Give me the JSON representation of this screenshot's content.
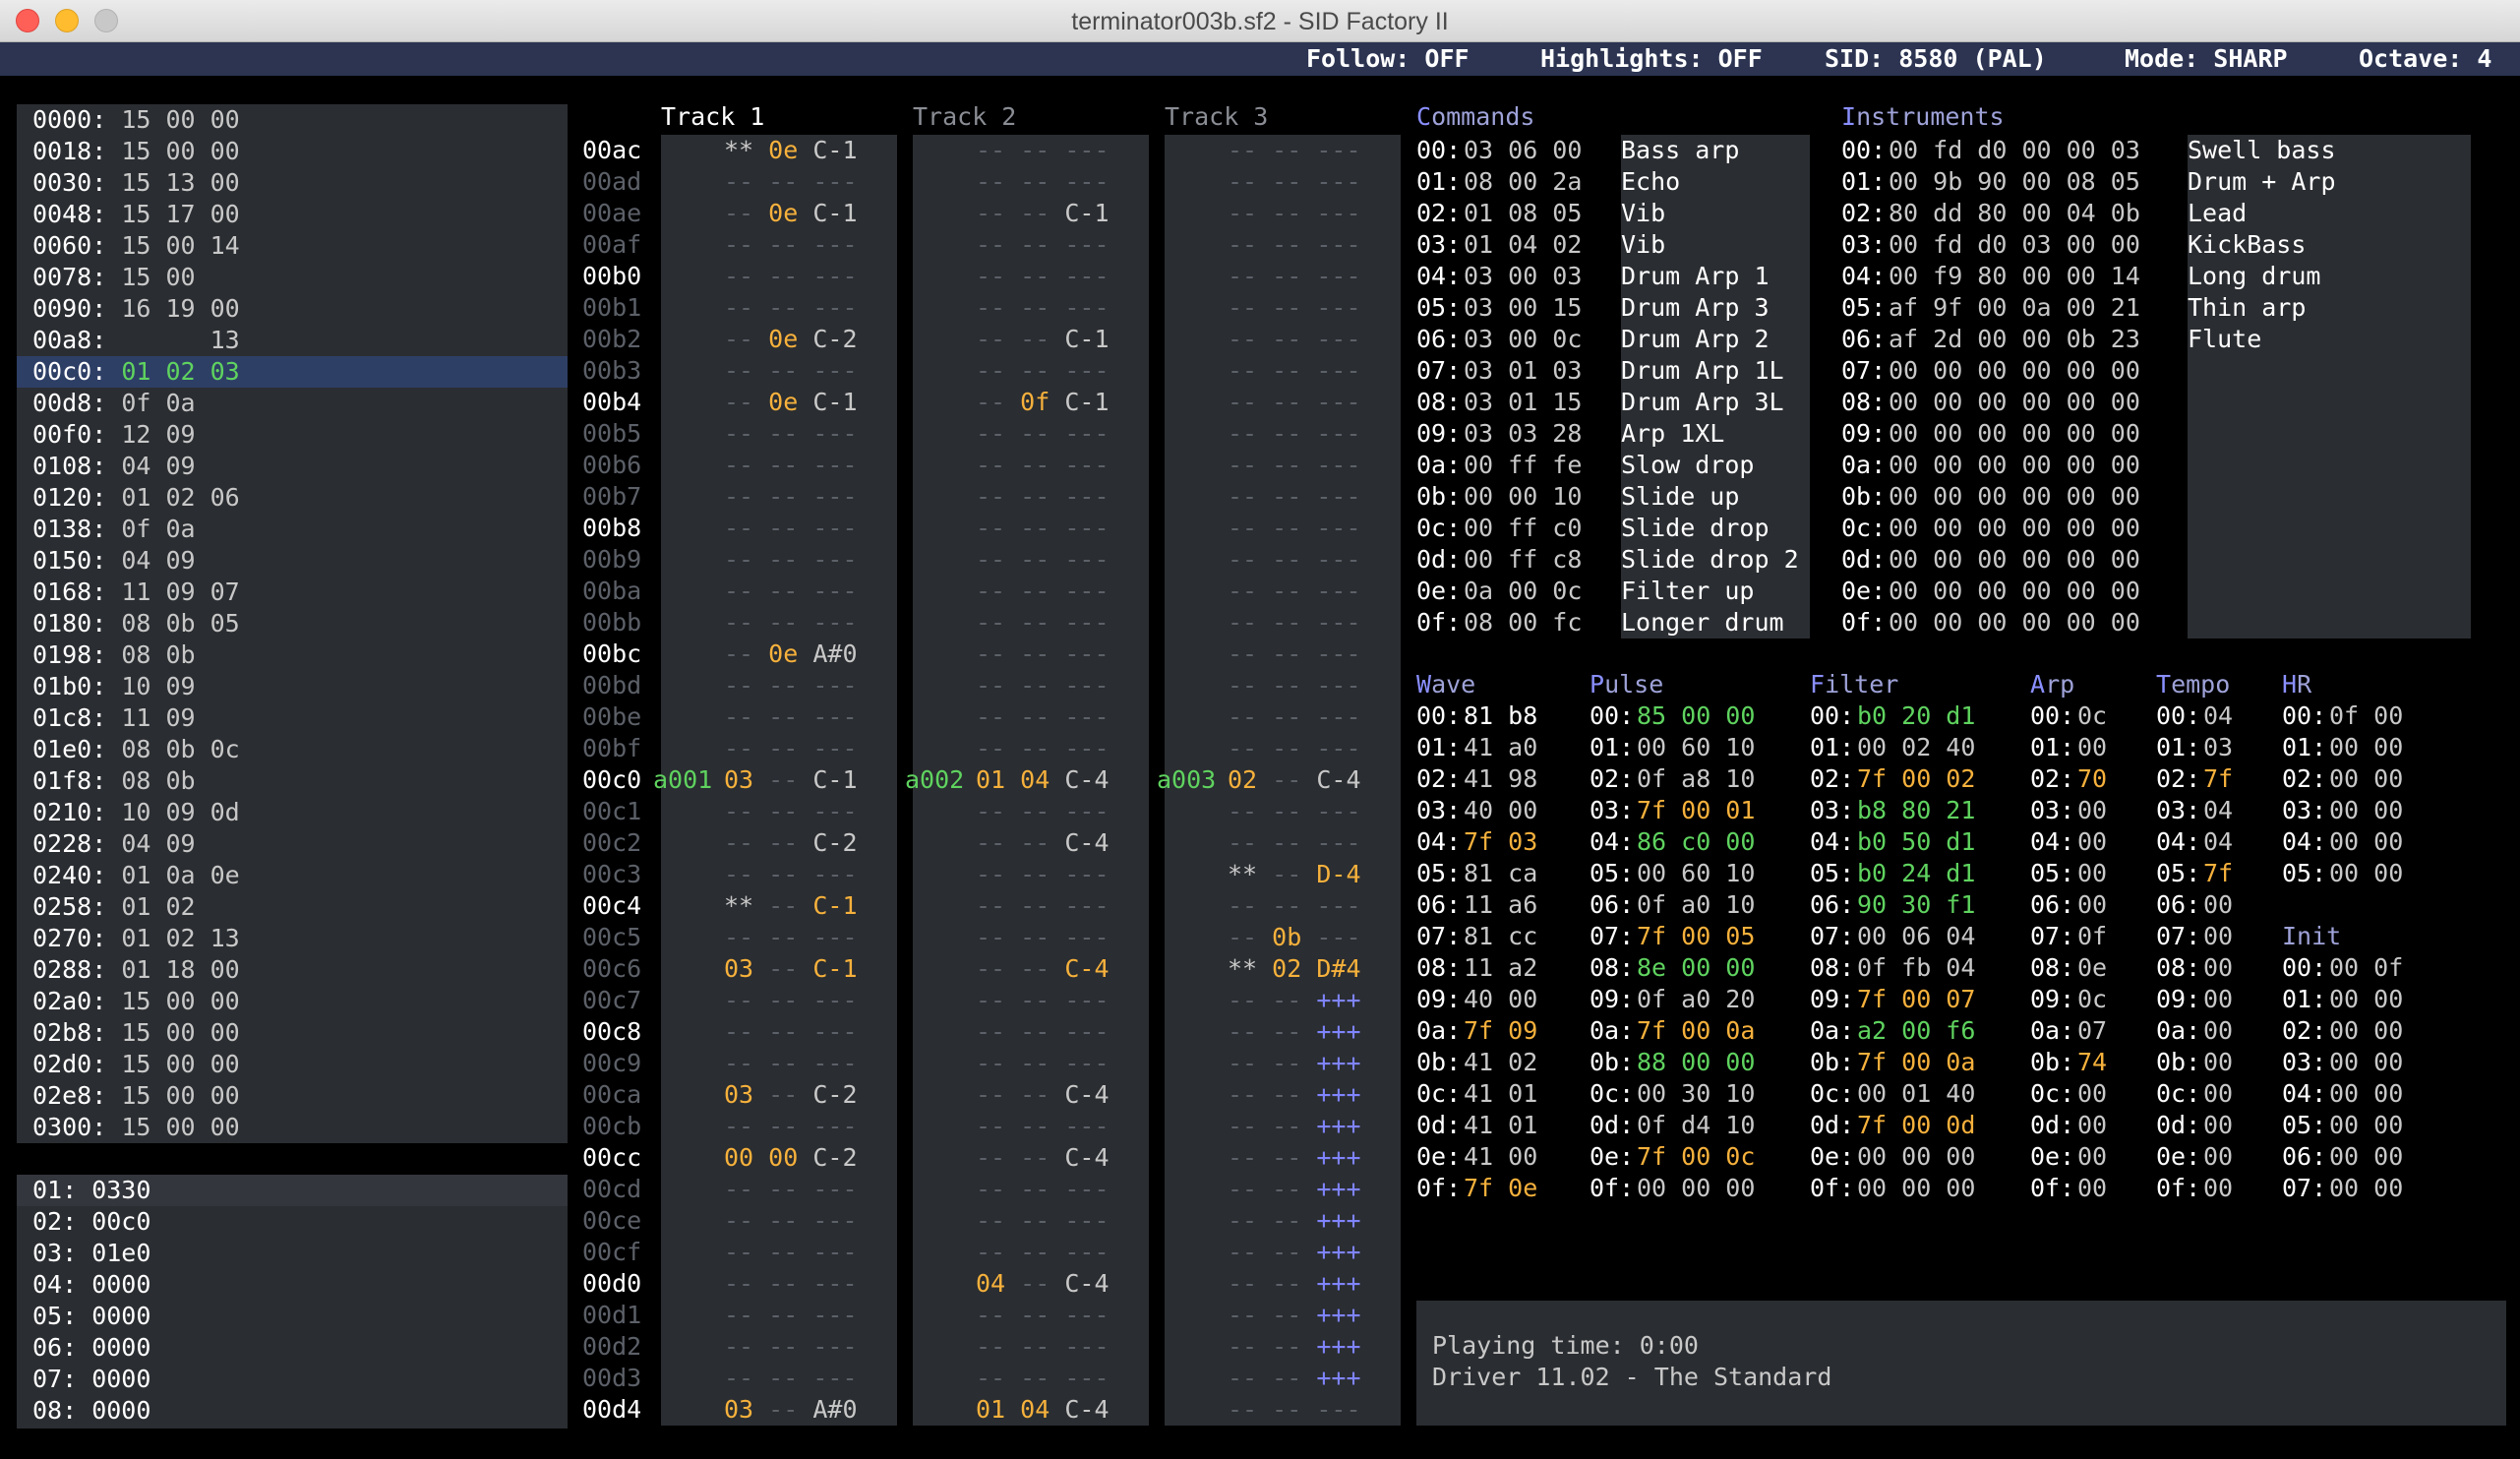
{
  "window": {
    "title": "terminator003b.sf2 - SID Factory II"
  },
  "status": {
    "follow": "Follow: OFF",
    "highlights": "Highlights: OFF",
    "sid": "SID: 8580 (PAL)",
    "mode": "Mode: SHARP",
    "octave": "Octave: 4"
  },
  "order_list": [
    {
      "a": "0000:",
      "v": "15 00 00"
    },
    {
      "a": "0018:",
      "v": "15 00 00"
    },
    {
      "a": "0030:",
      "v": "15 13 00"
    },
    {
      "a": "0048:",
      "v": "15 17 00"
    },
    {
      "a": "0060:",
      "v": "15 00 14"
    },
    {
      "a": "0078:",
      "v": "15 00"
    },
    {
      "a": "0090:",
      "v": "16 19 00"
    },
    {
      "a": "00a8:",
      "v": "      13"
    },
    {
      "a": "00c0:",
      "v": "01 02 03",
      "sel": true
    },
    {
      "a": "00d8:",
      "v": "0f 0a"
    },
    {
      "a": "00f0:",
      "v": "12 09"
    },
    {
      "a": "0108:",
      "v": "04 09"
    },
    {
      "a": "0120:",
      "v": "01 02 06"
    },
    {
      "a": "0138:",
      "v": "0f 0a"
    },
    {
      "a": "0150:",
      "v": "04 09"
    },
    {
      "a": "0168:",
      "v": "11 09 07"
    },
    {
      "a": "0180:",
      "v": "08 0b 05"
    },
    {
      "a": "0198:",
      "v": "08 0b"
    },
    {
      "a": "01b0:",
      "v": "10 09"
    },
    {
      "a": "01c8:",
      "v": "11 09"
    },
    {
      "a": "01e0:",
      "v": "08 0b 0c"
    },
    {
      "a": "01f8:",
      "v": "08 0b"
    },
    {
      "a": "0210:",
      "v": "10 09 0d"
    },
    {
      "a": "0228:",
      "v": "04 09"
    },
    {
      "a": "0240:",
      "v": "01 0a 0e"
    },
    {
      "a": "0258:",
      "v": "01 02"
    },
    {
      "a": "0270:",
      "v": "01 02 13"
    },
    {
      "a": "0288:",
      "v": "01 18 00"
    },
    {
      "a": "02a0:",
      "v": "15 00 00"
    },
    {
      "a": "02b8:",
      "v": "15 00 00"
    },
    {
      "a": "02d0:",
      "v": "15 00 00"
    },
    {
      "a": "02e8:",
      "v": "15 00 00"
    },
    {
      "a": "0300:",
      "v": "15 00 00"
    }
  ],
  "song_list": [
    "01: 0330",
    "02: 00c0",
    "03: 01e0",
    "04: 0000",
    "05: 0000",
    "06: 0000",
    "07: 0000",
    "08: 0000"
  ],
  "tracks": {
    "titles": [
      "Track 1",
      "Track 2",
      "Track 3"
    ]
  },
  "track_rows": [
    {
      "addr": "00ac",
      "t1": "** 0e C-1",
      "t2": "-- -- ---",
      "t3": "-- -- ---"
    },
    {
      "addr": "00ad",
      "t1": "-- -- ---",
      "t2": "-- -- ---",
      "t3": "-- -- ---"
    },
    {
      "addr": "00ae",
      "t1": "-- 0e C-1",
      "t2": "-- -- C-1",
      "t3": "-- -- ---"
    },
    {
      "addr": "00af",
      "t1": "-- -- ---",
      "t2": "-- -- ---",
      "t3": "-- -- ---"
    },
    {
      "addr": "00b0",
      "t1": "-- -- ---",
      "t2": "-- -- ---",
      "t3": "-- -- ---"
    },
    {
      "addr": "00b1",
      "t1": "-- -- ---",
      "t2": "-- -- ---",
      "t3": "-- -- ---"
    },
    {
      "addr": "00b2",
      "t1": "-- 0e C-2",
      "t2": "-- -- C-1",
      "t3": "-- -- ---"
    },
    {
      "addr": "00b3",
      "t1": "-- -- ---",
      "t2": "-- -- ---",
      "t3": "-- -- ---"
    },
    {
      "addr": "00b4",
      "t1": "-- 0e C-1",
      "t2": "-- 0f C-1",
      "t3": "-- -- ---"
    },
    {
      "addr": "00b5",
      "t1": "-- -- ---",
      "t2": "-- -- ---",
      "t3": "-- -- ---"
    },
    {
      "addr": "00b6",
      "t1": "-- -- ---",
      "t2": "-- -- ---",
      "t3": "-- -- ---"
    },
    {
      "addr": "00b7",
      "t1": "-- -- ---",
      "t2": "-- -- ---",
      "t3": "-- -- ---"
    },
    {
      "addr": "00b8",
      "t1": "-- -- ---",
      "t2": "-- -- ---",
      "t3": "-- -- ---"
    },
    {
      "addr": "00b9",
      "t1": "-- -- ---",
      "t2": "-- -- ---",
      "t3": "-- -- ---"
    },
    {
      "addr": "00ba",
      "t1": "-- -- ---",
      "t2": "-- -- ---",
      "t3": "-- -- ---"
    },
    {
      "addr": "00bb",
      "t1": "-- -- ---",
      "t2": "-- -- ---",
      "t3": "-- -- ---"
    },
    {
      "addr": "00bc",
      "t1": "-- 0e A#0",
      "t2": "-- -- ---",
      "t3": "-- -- ---"
    },
    {
      "addr": "00bd",
      "t1": "-- -- ---",
      "t2": "-- -- ---",
      "t3": "-- -- ---"
    },
    {
      "addr": "00be",
      "t1": "-- -- ---",
      "t2": "-- -- ---",
      "t3": "-- -- ---"
    },
    {
      "addr": "00bf",
      "t1": "-- -- ---",
      "t2": "-- -- ---",
      "t3": "-- -- ---"
    },
    {
      "addr": "00c0",
      "t1": "03 -- C-1",
      "t2": "01 04 C-4",
      "t3": "02 -- C-4",
      "s1": "a001",
      "s2": "a002",
      "s3": "a003"
    },
    {
      "addr": "00c1",
      "t1": "-- -- ---",
      "t2": "-- -- ---",
      "t3": "-- -- ---"
    },
    {
      "addr": "00c2",
      "t1": "-- -- C-2",
      "t2": "-- -- C-4",
      "t3": "-- -- ---"
    },
    {
      "addr": "00c3",
      "t1": "-- -- ---",
      "t2": "-- -- ---",
      "t3": "** -- D-4"
    },
    {
      "addr": "00c4",
      "t1": "** -- C-1",
      "t2": "-- -- ---",
      "t3": "-- -- ---"
    },
    {
      "addr": "00c5",
      "t1": "-- -- ---",
      "t2": "-- -- ---",
      "t3": "-- 0b ---"
    },
    {
      "addr": "00c6",
      "t1": "03 -- C-1",
      "t2": "-- -- C-4",
      "t3": "** 02 D#4"
    },
    {
      "addr": "00c7",
      "t1": "-- -- ---",
      "t2": "-- -- ---",
      "t3": "-- -- +++"
    },
    {
      "addr": "00c8",
      "t1": "-- -- ---",
      "t2": "-- -- ---",
      "t3": "-- -- +++"
    },
    {
      "addr": "00c9",
      "t1": "-- -- ---",
      "t2": "-- -- ---",
      "t3": "-- -- +++"
    },
    {
      "addr": "00ca",
      "t1": "03 -- C-2",
      "t2": "-- -- C-4",
      "t3": "-- -- +++"
    },
    {
      "addr": "00cb",
      "t1": "-- -- ---",
      "t2": "-- -- ---",
      "t3": "-- -- +++"
    },
    {
      "addr": "00cc",
      "t1": "00 00 C-2",
      "t2": "-- -- C-4",
      "t3": "-- -- +++"
    },
    {
      "addr": "00cd",
      "t1": "-- -- ---",
      "t2": "-- -- ---",
      "t3": "-- -- +++"
    },
    {
      "addr": "00ce",
      "t1": "-- -- ---",
      "t2": "-- -- ---",
      "t3": "-- -- +++"
    },
    {
      "addr": "00cf",
      "t1": "-- -- ---",
      "t2": "-- -- ---",
      "t3": "-- -- +++"
    },
    {
      "addr": "00d0",
      "t1": "-- -- ---",
      "t2": "04 -- C-4",
      "t3": "-- -- +++"
    },
    {
      "addr": "00d1",
      "t1": "-- -- ---",
      "t2": "-- -- ---",
      "t3": "-- -- +++"
    },
    {
      "addr": "00d2",
      "t1": "-- -- ---",
      "t2": "-- -- ---",
      "t3": "-- -- +++"
    },
    {
      "addr": "00d3",
      "t1": "-- -- ---",
      "t2": "-- -- ---",
      "t3": "-- -- +++"
    },
    {
      "addr": "00d4",
      "t1": "03 -- A#0",
      "t2": "01 04 C-4",
      "t3": "-- -- ---"
    }
  ],
  "commands": {
    "title": "Commands",
    "rows": [
      {
        "i": "00:",
        "h": "03 06 00",
        "n": "Bass arp"
      },
      {
        "i": "01:",
        "h": "08 00 2a",
        "n": "Echo"
      },
      {
        "i": "02:",
        "h": "01 08 05",
        "n": "Vib"
      },
      {
        "i": "03:",
        "h": "01 04 02",
        "n": "Vib"
      },
      {
        "i": "04:",
        "h": "03 00 03",
        "n": "Drum Arp 1"
      },
      {
        "i": "05:",
        "h": "03 00 15",
        "n": "Drum Arp 3"
      },
      {
        "i": "06:",
        "h": "03 00 0c",
        "n": "Drum Arp 2"
      },
      {
        "i": "07:",
        "h": "03 01 03",
        "n": "Drum Arp 1L"
      },
      {
        "i": "08:",
        "h": "03 01 15",
        "n": "Drum Arp 3L"
      },
      {
        "i": "09:",
        "h": "03 03 28",
        "n": "Arp 1XL"
      },
      {
        "i": "0a:",
        "h": "00 ff fe",
        "n": "Slow drop"
      },
      {
        "i": "0b:",
        "h": "00 00 10",
        "n": "Slide up"
      },
      {
        "i": "0c:",
        "h": "00 ff c0",
        "n": "Slide drop"
      },
      {
        "i": "0d:",
        "h": "00 ff c8",
        "n": "Slide drop 2"
      },
      {
        "i": "0e:",
        "h": "0a 00 0c",
        "n": "Filter up"
      },
      {
        "i": "0f:",
        "h": "08 00 fc",
        "n": "Longer drum"
      }
    ]
  },
  "instruments": {
    "title": "Instruments",
    "rows": [
      {
        "i": "00:",
        "h": "00 fd d0 00 00 03",
        "n": "Swell bass"
      },
      {
        "i": "01:",
        "h": "00 9b 90 00 08 05",
        "n": "Drum + Arp"
      },
      {
        "i": "02:",
        "h": "80 dd 80 00 04 0b",
        "n": "Lead"
      },
      {
        "i": "03:",
        "h": "00 fd d0 03 00 00",
        "n": "KickBass"
      },
      {
        "i": "04:",
        "h": "00 f9 80 00 00 14",
        "n": "Long drum"
      },
      {
        "i": "05:",
        "h": "af 9f 00 0a 00 21",
        "n": "Thin arp"
      },
      {
        "i": "06:",
        "h": "af 2d 00 00 0b 23",
        "n": "Flute"
      },
      {
        "i": "07:",
        "h": "00 00 00 00 00 00",
        "n": ""
      },
      {
        "i": "08:",
        "h": "00 00 00 00 00 00",
        "n": ""
      },
      {
        "i": "09:",
        "h": "00 00 00 00 00 00",
        "n": ""
      },
      {
        "i": "0a:",
        "h": "00 00 00 00 00 00",
        "n": ""
      },
      {
        "i": "0b:",
        "h": "00 00 00 00 00 00",
        "n": ""
      },
      {
        "i": "0c:",
        "h": "00 00 00 00 00 00",
        "n": ""
      },
      {
        "i": "0d:",
        "h": "00 00 00 00 00 00",
        "n": ""
      },
      {
        "i": "0e:",
        "h": "00 00 00 00 00 00",
        "n": ""
      },
      {
        "i": "0f:",
        "h": "00 00 00 00 00 00",
        "n": ""
      }
    ]
  },
  "wave": {
    "title": "Wave",
    "rows": [
      {
        "i": "00:",
        "h": "81 b8",
        "c": "w"
      },
      {
        "i": "01:",
        "h": "41 a0",
        "c": "g"
      },
      {
        "i": "02:",
        "h": "41 98",
        "c": "g"
      },
      {
        "i": "03:",
        "h": "40 00",
        "c": "g"
      },
      {
        "i": "04:",
        "h": "7f 03",
        "c": "o"
      },
      {
        "i": "05:",
        "h": "81 ca",
        "c": "g"
      },
      {
        "i": "06:",
        "h": "11 a6",
        "c": "g"
      },
      {
        "i": "07:",
        "h": "81 cc",
        "c": "g"
      },
      {
        "i": "08:",
        "h": "11 a2",
        "c": "g"
      },
      {
        "i": "09:",
        "h": "40 00",
        "c": "g"
      },
      {
        "i": "0a:",
        "h": "7f 09",
        "c": "o"
      },
      {
        "i": "0b:",
        "h": "41 02",
        "c": "g"
      },
      {
        "i": "0c:",
        "h": "41 01",
        "c": "g"
      },
      {
        "i": "0d:",
        "h": "41 01",
        "c": "g"
      },
      {
        "i": "0e:",
        "h": "41 00",
        "c": "g"
      },
      {
        "i": "0f:",
        "h": "7f 0e",
        "c": "o"
      }
    ]
  },
  "pulse": {
    "title": "Pulse",
    "rows": [
      {
        "i": "00:",
        "h": "85 00 00",
        "c": "gr"
      },
      {
        "i": "01:",
        "h": "00 60 10",
        "c": "g"
      },
      {
        "i": "02:",
        "h": "0f a8 10",
        "c": "g"
      },
      {
        "i": "03:",
        "h": "7f 00 01",
        "c": "o"
      },
      {
        "i": "04:",
        "h": "86 c0 00",
        "c": "gr"
      },
      {
        "i": "05:",
        "h": "00 60 10",
        "c": "g"
      },
      {
        "i": "06:",
        "h": "0f a0 10",
        "c": "g"
      },
      {
        "i": "07:",
        "h": "7f 00 05",
        "c": "o"
      },
      {
        "i": "08:",
        "h": "8e 00 00",
        "c": "gr"
      },
      {
        "i": "09:",
        "h": "0f a0 20",
        "c": "g"
      },
      {
        "i": "0a:",
        "h": "7f 00 0a",
        "c": "o"
      },
      {
        "i": "0b:",
        "h": "88 00 00",
        "c": "gr"
      },
      {
        "i": "0c:",
        "h": "00 30 10",
        "c": "g"
      },
      {
        "i": "0d:",
        "h": "0f d4 10",
        "c": "g"
      },
      {
        "i": "0e:",
        "h": "7f 00 0c",
        "c": "o"
      },
      {
        "i": "0f:",
        "h": "00 00 00",
        "c": "g"
      }
    ]
  },
  "filter": {
    "title": "Filter",
    "rows": [
      {
        "i": "00:",
        "h": "b0 20 d1",
        "c": "gr"
      },
      {
        "i": "01:",
        "h": "00 02 40",
        "c": "g"
      },
      {
        "i": "02:",
        "h": "7f 00 02",
        "c": "o"
      },
      {
        "i": "03:",
        "h": "b8 80 21",
        "c": "gr"
      },
      {
        "i": "04:",
        "h": "b0 50 d1",
        "c": "gr"
      },
      {
        "i": "05:",
        "h": "b0 24 d1",
        "c": "gr"
      },
      {
        "i": "06:",
        "h": "90 30 f1",
        "c": "gr"
      },
      {
        "i": "07:",
        "h": "00 06 04",
        "c": "g"
      },
      {
        "i": "08:",
        "h": "0f fb 04",
        "c": "g"
      },
      {
        "i": "09:",
        "h": "7f 00 07",
        "c": "o"
      },
      {
        "i": "0a:",
        "h": "a2 00 f6",
        "c": "gr"
      },
      {
        "i": "0b:",
        "h": "7f 00 0a",
        "c": "o"
      },
      {
        "i": "0c:",
        "h": "00 01 40",
        "c": "g"
      },
      {
        "i": "0d:",
        "h": "7f 00 0d",
        "c": "o"
      },
      {
        "i": "0e:",
        "h": "00 00 00",
        "c": "g"
      },
      {
        "i": "0f:",
        "h": "00 00 00",
        "c": "g"
      }
    ]
  },
  "arp": {
    "title": "Arp",
    "rows": [
      {
        "i": "00:",
        "h": "0c",
        "c": "g"
      },
      {
        "i": "01:",
        "h": "00",
        "c": "g"
      },
      {
        "i": "02:",
        "h": "70",
        "c": "o"
      },
      {
        "i": "03:",
        "h": "00",
        "c": "g"
      },
      {
        "i": "04:",
        "h": "00",
        "c": "g"
      },
      {
        "i": "05:",
        "h": "00",
        "c": "g"
      },
      {
        "i": "06:",
        "h": "00",
        "c": "g"
      },
      {
        "i": "07:",
        "h": "0f",
        "c": "g"
      },
      {
        "i": "08:",
        "h": "0e",
        "c": "g"
      },
      {
        "i": "09:",
        "h": "0c",
        "c": "g"
      },
      {
        "i": "0a:",
        "h": "07",
        "c": "g"
      },
      {
        "i": "0b:",
        "h": "74",
        "c": "o"
      },
      {
        "i": "0c:",
        "h": "00",
        "c": "g"
      },
      {
        "i": "0d:",
        "h": "00",
        "c": "g"
      },
      {
        "i": "0e:",
        "h": "00",
        "c": "g"
      },
      {
        "i": "0f:",
        "h": "00",
        "c": "g"
      }
    ]
  },
  "tempo": {
    "title": "Tempo",
    "rows": [
      {
        "i": "00:",
        "h": "04",
        "c": "g"
      },
      {
        "i": "01:",
        "h": "03",
        "c": "g"
      },
      {
        "i": "02:",
        "h": "7f",
        "c": "o"
      },
      {
        "i": "03:",
        "h": "04",
        "c": "g"
      },
      {
        "i": "04:",
        "h": "04",
        "c": "g"
      },
      {
        "i": "05:",
        "h": "7f",
        "c": "o"
      },
      {
        "i": "06:",
        "h": "00",
        "c": "g"
      },
      {
        "i": "07:",
        "h": "00",
        "c": "g"
      },
      {
        "i": "08:",
        "h": "00",
        "c": "g"
      },
      {
        "i": "09:",
        "h": "00",
        "c": "g"
      },
      {
        "i": "0a:",
        "h": "00",
        "c": "g"
      },
      {
        "i": "0b:",
        "h": "00",
        "c": "g"
      },
      {
        "i": "0c:",
        "h": "00",
        "c": "g"
      },
      {
        "i": "0d:",
        "h": "00",
        "c": "g"
      },
      {
        "i": "0e:",
        "h": "00",
        "c": "g"
      },
      {
        "i": "0f:",
        "h": "00",
        "c": "g"
      }
    ]
  },
  "hr": {
    "title": "HR",
    "rows": [
      {
        "i": "00:",
        "h": "0f 00"
      },
      {
        "i": "01:",
        "h": "00 00"
      },
      {
        "i": "02:",
        "h": "00 00"
      },
      {
        "i": "03:",
        "h": "00 00"
      },
      {
        "i": "04:",
        "h": "00 00"
      },
      {
        "i": "05:",
        "h": "00 00"
      }
    ]
  },
  "init": {
    "title": "Init",
    "rows": [
      {
        "i": "00:",
        "h": "00 0f"
      },
      {
        "i": "01:",
        "h": "00 00"
      },
      {
        "i": "02:",
        "h": "00 00"
      },
      {
        "i": "03:",
        "h": "00 00"
      },
      {
        "i": "04:",
        "h": "00 00"
      },
      {
        "i": "05:",
        "h": "00 00"
      },
      {
        "i": "06:",
        "h": "00 00"
      },
      {
        "i": "07:",
        "h": "00 00"
      }
    ]
  },
  "info": {
    "playing_time": "Playing time: 0:00",
    "driver": "Driver 11.02 - The Standard"
  },
  "colors": {
    "background": "#000000",
    "panel": "#2a2d31",
    "status_bar": "#2c3452",
    "selection": "#2e3f66",
    "white": "#ffffff",
    "gray": "#c8c8c8",
    "dim": "#5c6068",
    "orange": "#f6b13c",
    "green": "#5fd35f",
    "blue": "#7f84ff"
  }
}
